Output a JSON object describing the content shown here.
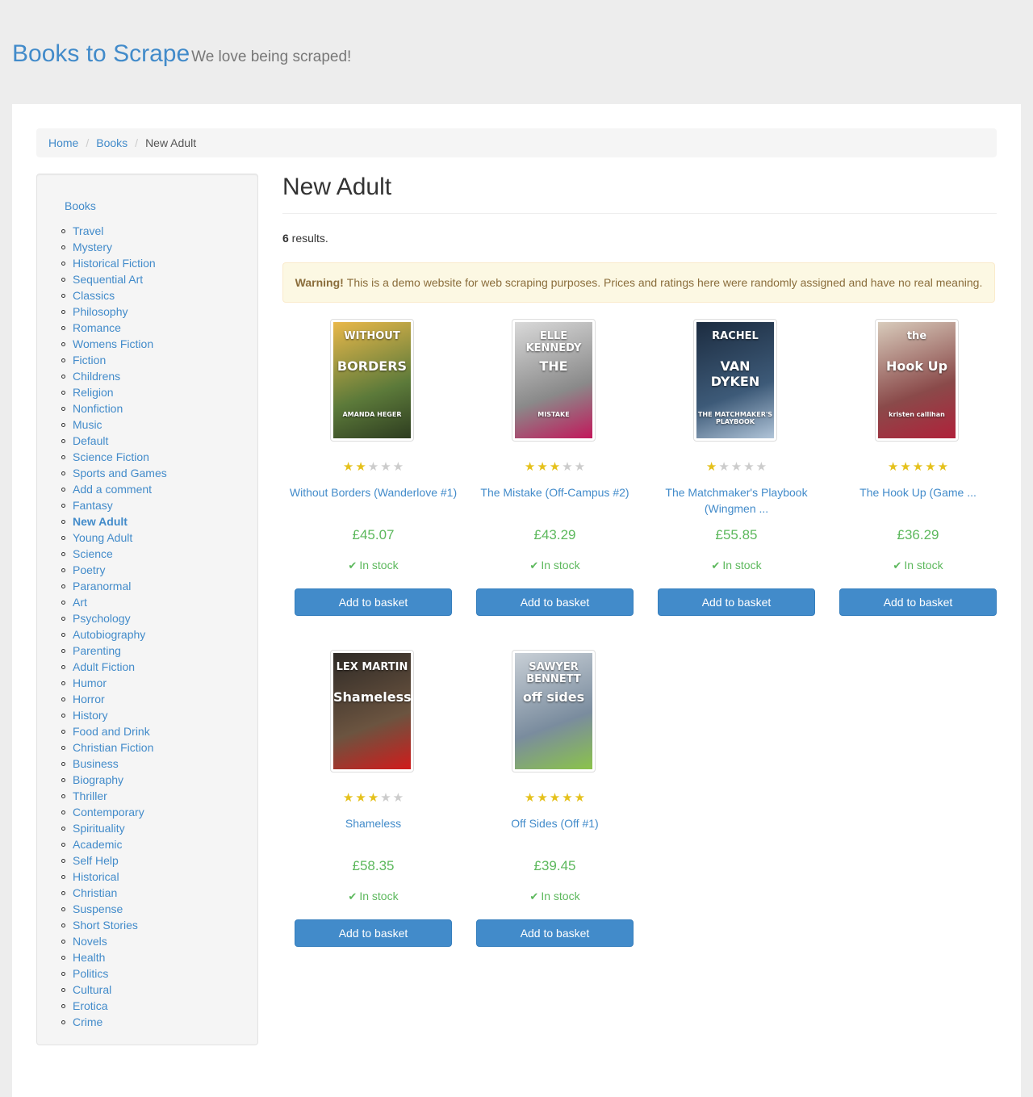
{
  "header": {
    "brand": "Books to Scrape",
    "tagline": "We love being scraped!"
  },
  "breadcrumb": {
    "items": [
      "Home",
      "Books"
    ],
    "active": "New Adult"
  },
  "sidebar": {
    "root": "Books",
    "categories": [
      "Travel",
      "Mystery",
      "Historical Fiction",
      "Sequential Art",
      "Classics",
      "Philosophy",
      "Romance",
      "Womens Fiction",
      "Fiction",
      "Childrens",
      "Religion",
      "Nonfiction",
      "Music",
      "Default",
      "Science Fiction",
      "Sports and Games",
      "Add a comment",
      "Fantasy",
      "New Adult",
      "Young Adult",
      "Science",
      "Poetry",
      "Paranormal",
      "Art",
      "Psychology",
      "Autobiography",
      "Parenting",
      "Adult Fiction",
      "Humor",
      "Horror",
      "History",
      "Food and Drink",
      "Christian Fiction",
      "Business",
      "Biography",
      "Thriller",
      "Contemporary",
      "Spirituality",
      "Academic",
      "Self Help",
      "Historical",
      "Christian",
      "Suspense",
      "Short Stories",
      "Novels",
      "Health",
      "Politics",
      "Cultural",
      "Erotica",
      "Crime"
    ],
    "current": "New Adult"
  },
  "main": {
    "title": "New Adult",
    "results_count": "6",
    "results_suffix": " results.",
    "alert_strong": "Warning!",
    "alert_text": "This is a demo website for web scraping purposes. Prices and ratings here were randomly assigned and have no real meaning.",
    "star_color": "#e5c11c",
    "price_color": "#5cb85c",
    "products": [
      {
        "title": "Without Borders (Wanderlove #1)",
        "price": "£45.07",
        "rating": 2,
        "stock": "In stock",
        "button": "Add to basket",
        "cover_lines": [
          "WITHOUT",
          "BORDERS",
          "AMANDA HEGER"
        ],
        "cover_colors": [
          "#e9b84a",
          "#5c7a3a",
          "#2e3d20"
        ]
      },
      {
        "title": "The Mistake (Off-Campus #2)",
        "price": "£43.29",
        "rating": 3,
        "stock": "In stock",
        "button": "Add to basket",
        "cover_lines": [
          "ELLE KENNEDY",
          "THE",
          "MISTAKE"
        ],
        "cover_colors": [
          "#d9d9d9",
          "#8a8a8a",
          "#c2185b"
        ]
      },
      {
        "title": "The Matchmaker's Playbook (Wingmen ...",
        "price": "£55.85",
        "rating": 1,
        "stock": "In stock",
        "button": "Add to basket",
        "cover_lines": [
          "RACHEL",
          "VAN DYKEN",
          "THE MATCHMAKER'S PLAYBOOK"
        ],
        "cover_colors": [
          "#1c2c40",
          "#3d5a78",
          "#b0c4d8"
        ]
      },
      {
        "title": "The Hook Up (Game ...",
        "price": "£36.29",
        "rating": 5,
        "stock": "In stock",
        "button": "Add to basket",
        "cover_lines": [
          "the",
          "Hook Up",
          "kristen callihan"
        ],
        "cover_colors": [
          "#d8cbbb",
          "#8a4a4a",
          "#b0213a"
        ]
      },
      {
        "title": "Shameless",
        "price": "£58.35",
        "rating": 3,
        "stock": "In stock",
        "button": "Add to basket",
        "cover_lines": [
          "LEX MARTIN",
          "Shameless"
        ],
        "cover_colors": [
          "#2e2a26",
          "#6b5440",
          "#d11b1b"
        ]
      },
      {
        "title": "Off Sides (Off #1)",
        "price": "£39.45",
        "rating": 5,
        "stock": "In stock",
        "button": "Add to basket",
        "cover_lines": [
          "SAWYER BENNETT",
          "off sides"
        ],
        "cover_colors": [
          "#c8cfd6",
          "#7a8c9e",
          "#8bc34a"
        ]
      }
    ]
  }
}
